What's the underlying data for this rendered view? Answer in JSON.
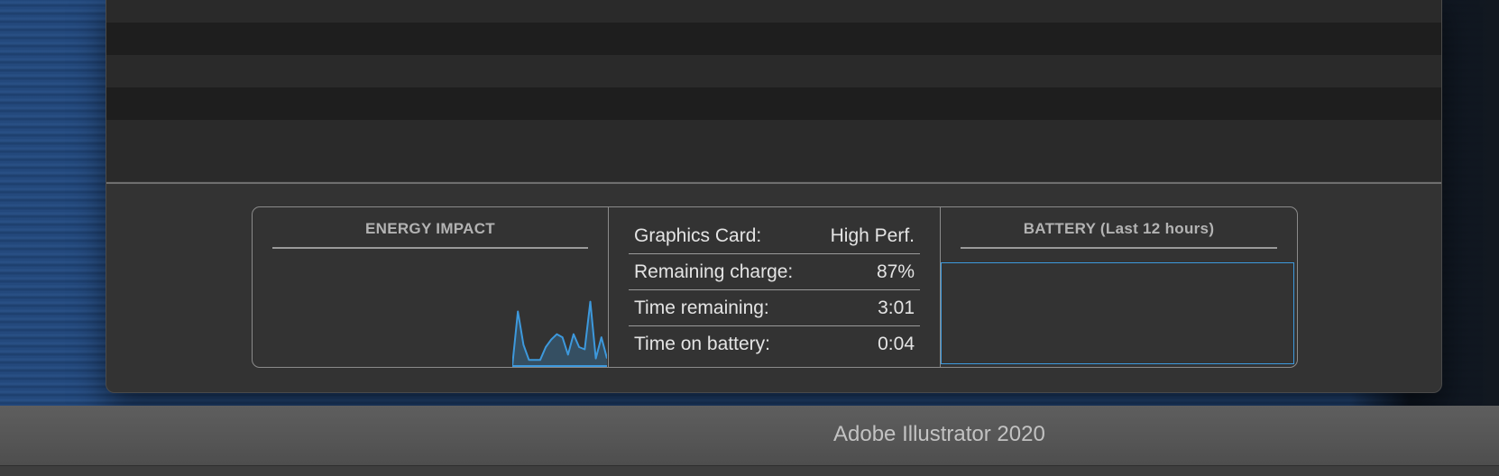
{
  "energy_impact": {
    "title": "ENERGY IMPACT",
    "graph_color": "#3d99dd",
    "graph_samples": [
      0.0,
      0.72,
      0.28,
      0.08,
      0.08,
      0.08,
      0.25,
      0.35,
      0.42,
      0.38,
      0.15,
      0.42,
      0.25,
      0.22,
      0.85,
      0.1,
      0.38,
      0.1
    ]
  },
  "stats": {
    "rows": [
      {
        "label": "Graphics Card:",
        "value": "High Perf."
      },
      {
        "label": "Remaining charge:",
        "value": "87%"
      },
      {
        "label": "Time remaining:",
        "value": "3:01"
      },
      {
        "label": "Time on battery:",
        "value": "0:04"
      }
    ]
  },
  "battery": {
    "title": "BATTERY (Last 12 hours)",
    "graph_color": "#3d99dd"
  },
  "dock": {
    "app_label": "Adobe Illustrator 2020"
  }
}
